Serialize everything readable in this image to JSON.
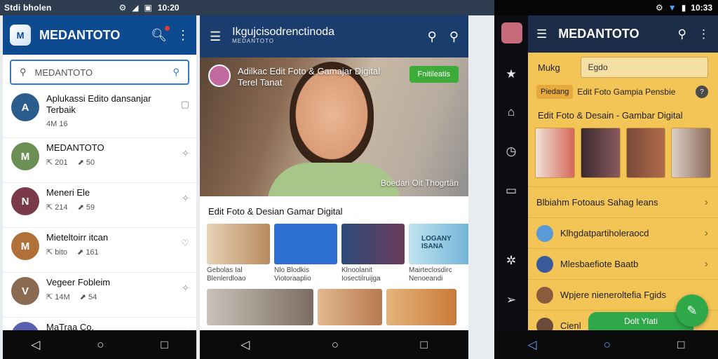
{
  "status": {
    "left_label": "Stdi bholen",
    "time_left": "10:20",
    "time_right": "10:33"
  },
  "panel1": {
    "title": "MEDANTOTO",
    "search_value": "MEDANTOTO",
    "items": [
      {
        "name": "Aplukassi Edito dansanjar Terbaik",
        "meta1": "4M 16",
        "meta2": "",
        "color": "#2a5c8c"
      },
      {
        "name": "MEDANTOTO",
        "meta1": "201",
        "meta2": "50",
        "color": "#6b8f54"
      },
      {
        "name": "Meneri Ele",
        "meta1": "214",
        "meta2": "59",
        "color": "#7a3a4a"
      },
      {
        "name": "Mieteltoirr itcan",
        "meta1": "bito",
        "meta2": "161",
        "color": "#b0703a"
      },
      {
        "name": "Vegeer Fobleim",
        "meta1": "14M",
        "meta2": "54",
        "color": "#8a6a50"
      },
      {
        "name": "MaTraa Co.",
        "meta1": "",
        "meta2": "",
        "color": "#5a5fb0"
      }
    ]
  },
  "panel2": {
    "appbar_title": "Ikgujcisodrenctinoda",
    "appbar_sub": "MEDANTOTO",
    "hero_title": "Adilkac Edit Foto & Gamajar Digital Terel Tanat",
    "hero_pill": "Fnitileatis",
    "hero_caption": "Boedari Oit Thogrtän",
    "section_title": "Edit Foto & Desian Gamar Digital",
    "tiles": [
      {
        "caption": "Gebolas Ial Blenlerdloao",
        "color": "#d9c4a8"
      },
      {
        "caption": "Nlo Blodkis Viotoraaplio",
        "color": "#2e6fd3"
      },
      {
        "caption": "Klnoolanit Iosectilruijga",
        "color": "#2d4a7a"
      },
      {
        "caption": "Mairteclosdirc Nenoeandi",
        "color": "#6fb2d6"
      }
    ],
    "tile_label": "LOGANY ISANA"
  },
  "panel3": {
    "title": "MEDANTOTO",
    "search_label": "Mukg",
    "search_value": "Egdo",
    "chip": "Piedang",
    "chip_title": "Edit Foto Gampia Pensbie",
    "section_title": "Edit Foto & Desain - Gambar Digital",
    "rows": [
      {
        "text": "Blbiahm Fotoaus Sahag leans",
        "color": "#e9b44e"
      },
      {
        "text": "Klhgdatpartiholeraocd",
        "color": "#5b9bd5"
      },
      {
        "text": "Mlesbaefiote Baatb",
        "color": "#3a5a9c"
      },
      {
        "text": "Wpjere nieneroltefia Fgids",
        "color": "#8c5a3c"
      },
      {
        "text": "Cienl",
        "color": "#6a4a3a"
      }
    ],
    "green_button": "Dolt Ylati"
  }
}
